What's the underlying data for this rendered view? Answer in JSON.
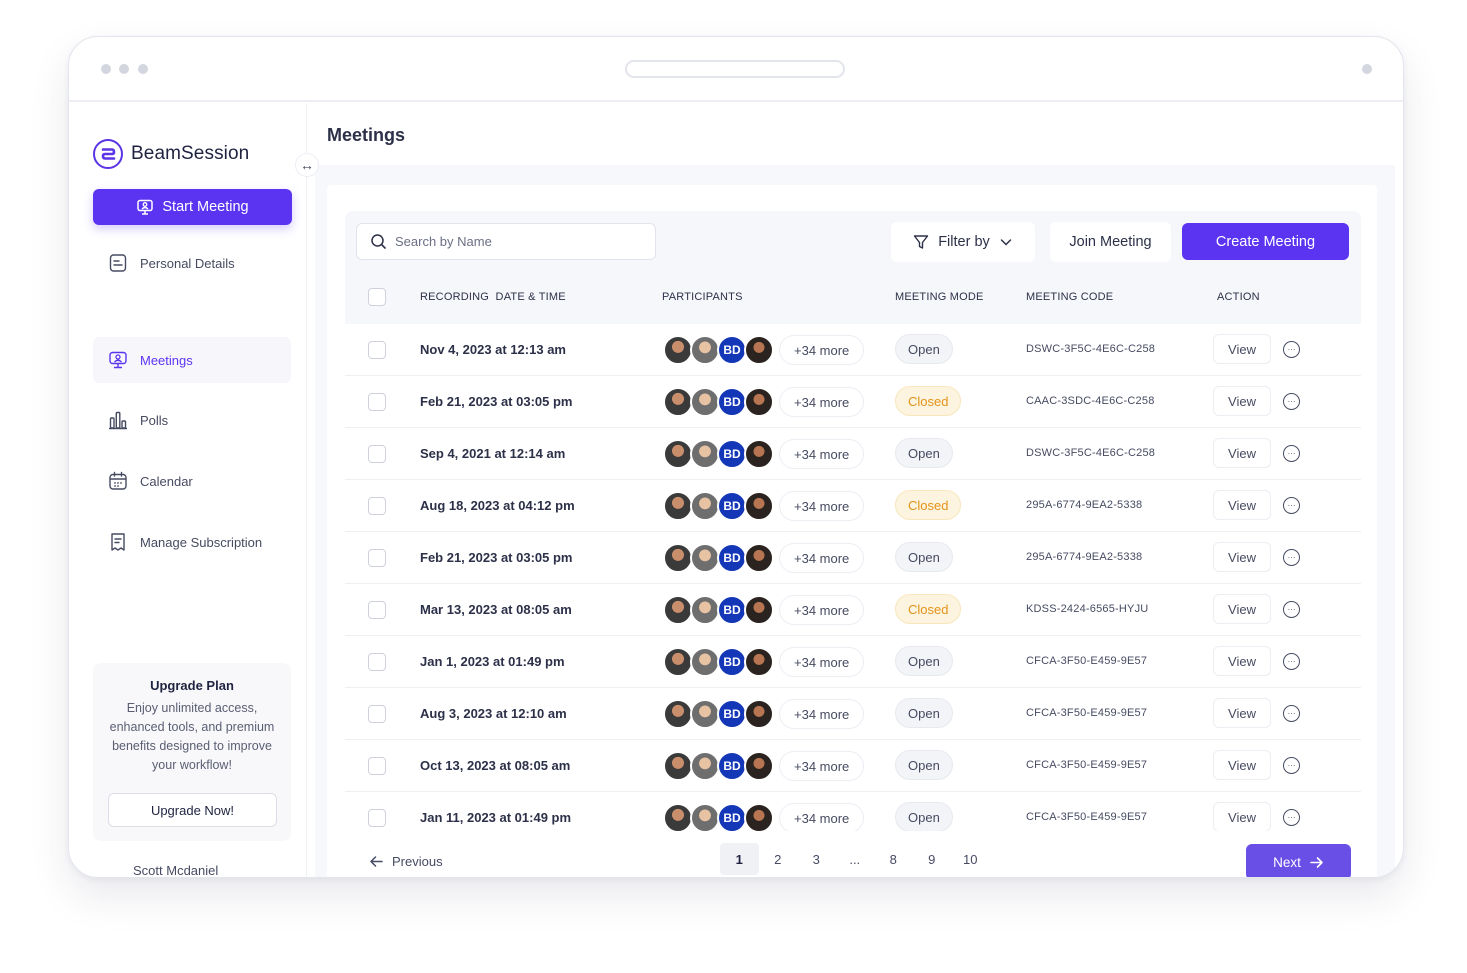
{
  "app": {
    "name": "BeamSession",
    "page_title": "Meetings",
    "accent": "#5b34f2"
  },
  "sidebar": {
    "start_label": "Start Meeting",
    "items": [
      {
        "label": "Personal Details",
        "icon": "document-icon",
        "active": false
      },
      {
        "label": "Meetings",
        "icon": "meetings-icon",
        "active": true
      },
      {
        "label": "Polls",
        "icon": "bar-chart-icon",
        "active": false
      },
      {
        "label": "Calendar",
        "icon": "calendar-icon",
        "active": false
      },
      {
        "label": "Manage Subscription",
        "icon": "receipt-icon",
        "active": false
      }
    ],
    "upgrade": {
      "title": "Upgrade Plan",
      "text": "Enjoy unlimited access, enhanced tools, and premium benefits designed to improve your workflow!",
      "button": "Upgrade Now!"
    },
    "user_name": "Scott Mcdaniel"
  },
  "toolbar": {
    "search_placeholder": "Search by Name",
    "filter_label": "Filter by",
    "join_label": "Join Meeting",
    "create_label": "Create Meeting"
  },
  "table": {
    "headers": {
      "recording": "RECORDING",
      "datetime": "DATE & TIME",
      "participants": "PARTICIPANTS",
      "mode": "MEETING MODE",
      "code": "MEETING CODE",
      "action": "ACTION"
    },
    "initials": "BD",
    "rows": [
      {
        "date": "Nov 4, 2023 at 12:13 am",
        "more": "+34 more",
        "mode": "Open",
        "code": "DSWC-3F5C-4E6C-C258",
        "view": "View"
      },
      {
        "date": "Feb 21, 2023 at 03:05 pm",
        "more": "+34 more",
        "mode": "Closed",
        "code": "CAAC-3SDC-4E6C-C258",
        "view": "View"
      },
      {
        "date": "Sep 4, 2021 at 12:14 am",
        "more": "+34 more",
        "mode": "Open",
        "code": "DSWC-3F5C-4E6C-C258",
        "view": "View"
      },
      {
        "date": "Aug 18, 2023 at 04:12 pm",
        "more": "+34 more",
        "mode": "Closed",
        "code": "295A-6774-9EA2-5338",
        "view": "View"
      },
      {
        "date": "Feb 21, 2023 at 03:05 pm",
        "more": "+34 more",
        "mode": "Open",
        "code": "295A-6774-9EA2-5338",
        "view": "View"
      },
      {
        "date": "Mar 13, 2023 at 08:05 am",
        "more": "+34 more",
        "mode": "Closed",
        "code": "KDSS-2424-6565-HYJU",
        "view": "View"
      },
      {
        "date": "Jan 1, 2023 at 01:49 pm",
        "more": "+34 more",
        "mode": "Open",
        "code": "CFCA-3F50-E459-9E57",
        "view": "View"
      },
      {
        "date": "Aug 3, 2023 at 12:10 am",
        "more": "+34 more",
        "mode": "Open",
        "code": "CFCA-3F50-E459-9E57",
        "view": "View"
      },
      {
        "date": "Oct 13, 2023 at 08:05 am",
        "more": "+34 more",
        "mode": "Open",
        "code": "CFCA-3F50-E459-9E57",
        "view": "View"
      },
      {
        "date": "Jan 11, 2023 at 01:49 pm",
        "more": "+34 more",
        "mode": "Open",
        "code": "CFCA-3F50-E459-9E57",
        "view": "View"
      }
    ]
  },
  "pagination": {
    "prev_label": "Previous",
    "next_label": "Next",
    "pages": [
      "1",
      "2",
      "3",
      "...",
      "8",
      "9",
      "10"
    ],
    "current": "1"
  }
}
